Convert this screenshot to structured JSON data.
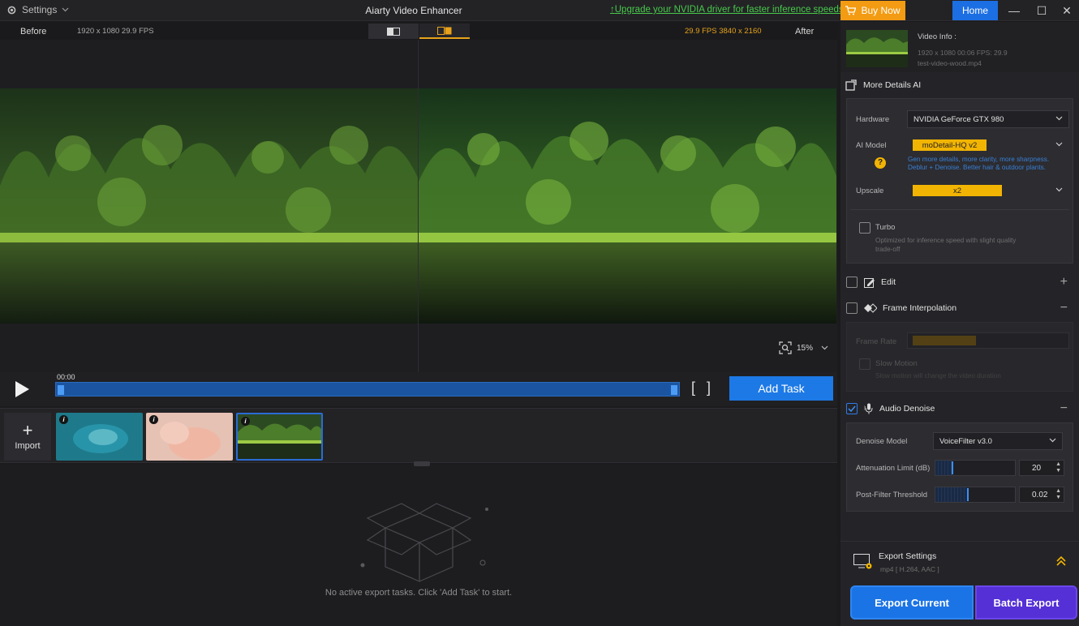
{
  "titlebar": {
    "settings_label": "Settings",
    "app_title": "Aiarty Video Enhancer",
    "upgrade_text": "Upgrade your NVIDIA driver for faster inference speeds.",
    "buy_now": "Buy Now",
    "home": "Home"
  },
  "preview": {
    "before_label": "Before",
    "after_label": "After",
    "before_info": "1920 x 1080  29.9 FPS",
    "after_info": "29.9 FPS  3840 x 2160",
    "zoom": "15%"
  },
  "timeline": {
    "current_time": "00:00",
    "add_task": "Add Task"
  },
  "filmstrip": {
    "import_label": "Import",
    "thumbs": [
      "jellyfish",
      "baby",
      "forest-lake"
    ]
  },
  "tasks": {
    "empty_message": "No active export tasks. Click 'Add Task' to start."
  },
  "sidebar": {
    "video_info": {
      "title": "Video Info :",
      "meta_line1": "1920 x 1080  00:06   FPS: 29.9",
      "meta_line2": "test-video-wood.mp4"
    },
    "more_details": {
      "title": "More Details AI",
      "hardware_label": "Hardware",
      "hardware_value": "NVIDIA GeForce GTX 980",
      "ai_model_label": "AI Model",
      "ai_model_value": "moDetail-HQ  v2",
      "ai_model_hint1": "Gen more details, more clarity, more sharpness.",
      "ai_model_hint2": "Deblur + Denoise. Better hair & outdoor plants.",
      "upscale_label": "Upscale",
      "upscale_value": "x2",
      "turbo_label": "Turbo",
      "turbo_hint1": "Optimized for inference speed with slight quality",
      "turbo_hint2": "trade-off"
    },
    "edit": {
      "title": "Edit"
    },
    "frame_interp": {
      "title": "Frame Interpolation",
      "frame_rate_label": "Frame Rate",
      "slow_motion_label": "Slow Motion",
      "slow_motion_hint": "Slow motion will change the video duration"
    },
    "audio_denoise": {
      "title": "Audio Denoise",
      "model_label": "Denoise Model",
      "model_value": "VoiceFilter v3.0",
      "attenuation_label": "Attenuation Limit (dB)",
      "attenuation_value": "20",
      "attenuation_level": 0.2,
      "postfilter_label": "Post-Filter Threshold",
      "postfilter_value": "0.02",
      "postfilter_level": 0.4
    },
    "export": {
      "title": "Export Settings",
      "format": "mp4 [ H.264, AAC ]",
      "export_current": "Export Current",
      "batch_export": "Batch Export"
    }
  },
  "colors": {
    "accent_blue": "#1d79e6",
    "accent_orange": "#f39b12",
    "accent_yellow": "#f2b402",
    "batch_purple": "#5430d6",
    "link_green": "#48c94a"
  }
}
